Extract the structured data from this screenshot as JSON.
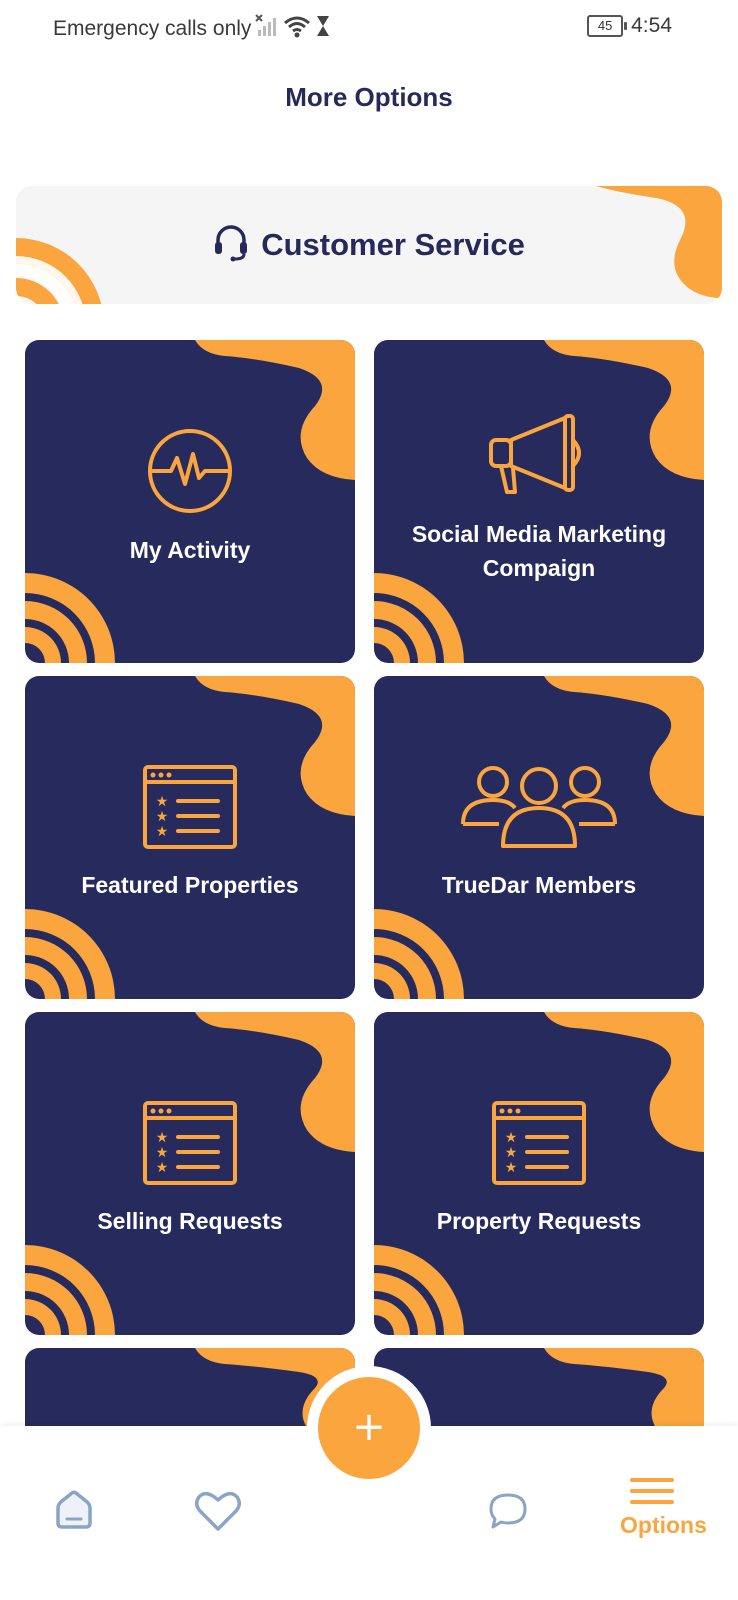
{
  "status_bar": {
    "carrier_text": "Emergency calls only",
    "battery": "45",
    "time": "4:54"
  },
  "page_title": "More Options",
  "customer_service": {
    "label": "Customer Service",
    "icon": "headset-icon"
  },
  "cards": [
    {
      "label": "My Activity",
      "icon": "activity-pulse-icon"
    },
    {
      "label": "Social Media Marketing Compaign",
      "icon": "megaphone-icon"
    },
    {
      "label": "Featured Properties",
      "icon": "starred-list-icon"
    },
    {
      "label": "TrueDar Members",
      "icon": "members-group-icon"
    },
    {
      "label": "Selling Requests",
      "icon": "starred-list-icon"
    },
    {
      "label": "Property Requests",
      "icon": "starred-list-icon"
    }
  ],
  "bottom_nav": {
    "fab_label": "+",
    "items": [
      {
        "icon": "home-icon"
      },
      {
        "icon": "heart-icon"
      },
      {
        "icon": "chat-icon"
      },
      {
        "icon": "menu-icon",
        "label": "Options"
      }
    ]
  },
  "colors": {
    "navy": "#262a5c",
    "orange": "#fba53f",
    "title": "#27295a"
  }
}
